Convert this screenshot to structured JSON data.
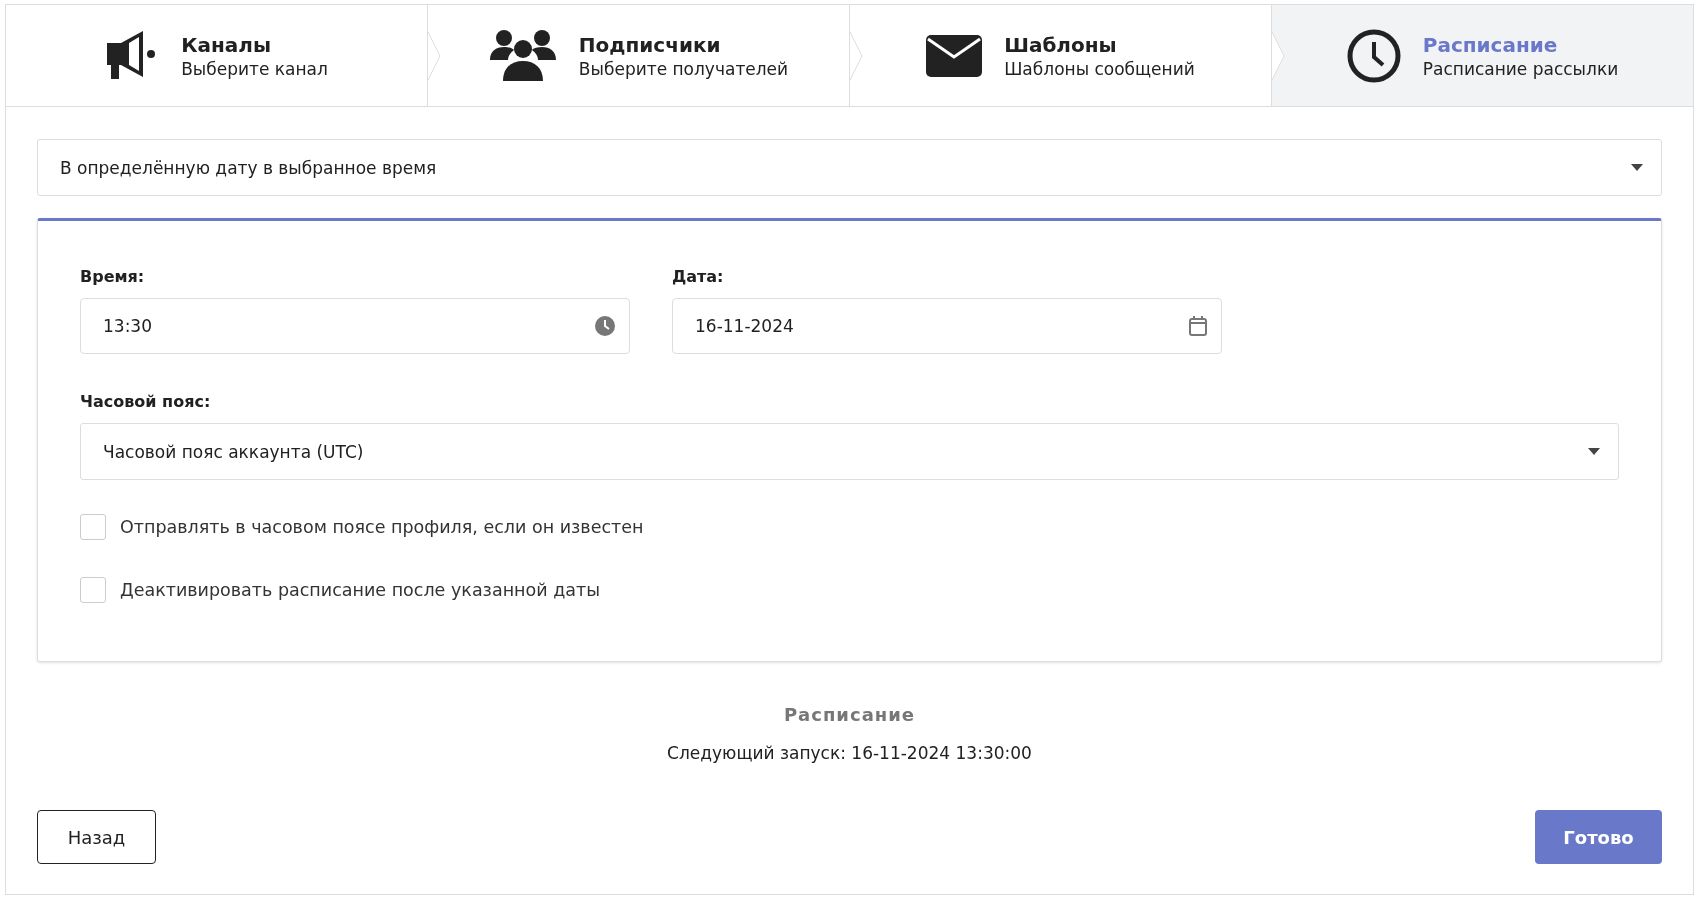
{
  "steps": [
    {
      "kind": "megaphone",
      "title": "Каналы",
      "subtitle": "Выберите канал",
      "selected": false
    },
    {
      "kind": "users",
      "title": "Подписчики",
      "subtitle": "Выберите получателей",
      "selected": false
    },
    {
      "kind": "envelope",
      "title": "Шаблоны",
      "subtitle": "Шаблоны сообщений",
      "selected": false
    },
    {
      "kind": "clock",
      "title": "Расписание",
      "subtitle": "Расписание рассылки",
      "selected": true
    }
  ],
  "schedule_type": {
    "value": "В определённую дату в выбранное время"
  },
  "time": {
    "label": "Время:",
    "value": "13:30"
  },
  "date": {
    "label": "Дата:",
    "value": "16-11-2024"
  },
  "timezone": {
    "label": "Часовой пояс:",
    "value": "Часовой пояс аккаунта (UTC)"
  },
  "options": [
    {
      "label": "Отправлять в часовом поясе профиля, если он известен",
      "checked": false
    },
    {
      "label": "Деактивировать расписание после указанной даты",
      "checked": false
    }
  ],
  "summary": {
    "title": "Расписание",
    "next_run": "Следующий запуск: 16-11-2024 13:30:00"
  },
  "buttons": {
    "back": "Назад",
    "done": "Готово"
  }
}
